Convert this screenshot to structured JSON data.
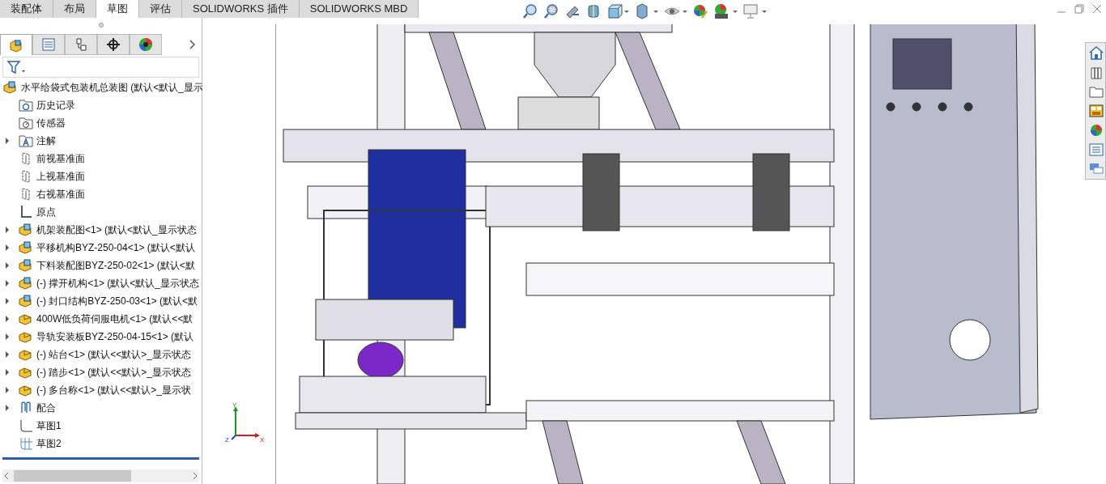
{
  "command_tabs": [
    {
      "label": "装配体",
      "selected": false
    },
    {
      "label": "布局",
      "selected": false
    },
    {
      "label": "草图",
      "selected": true
    },
    {
      "label": "评估",
      "selected": false
    },
    {
      "label": "SOLIDWORKS 插件",
      "selected": false
    },
    {
      "label": "SOLIDWORKS MBD",
      "selected": false
    }
  ],
  "manager_tabs": [
    {
      "kind": "feature",
      "selected": true
    },
    {
      "kind": "property",
      "selected": false
    },
    {
      "kind": "config",
      "selected": false
    },
    {
      "kind": "dimxpert",
      "selected": false
    },
    {
      "kind": "display",
      "selected": false
    }
  ],
  "feature_tree": [
    {
      "kind": "assembly",
      "label": "水平给袋式包装机总装图  (默认<默认_显示",
      "root": true
    },
    {
      "kind": "history",
      "label": "历史记录",
      "expandable": false
    },
    {
      "kind": "sensor",
      "label": "传感器",
      "expandable": false
    },
    {
      "kind": "annotation",
      "label": "注解",
      "expandable": true
    },
    {
      "kind": "plane",
      "label": "前视基准面",
      "expandable": false
    },
    {
      "kind": "plane",
      "label": "上视基准面",
      "expandable": false
    },
    {
      "kind": "plane",
      "label": "右视基准面",
      "expandable": false
    },
    {
      "kind": "origin",
      "label": "原点",
      "expandable": false
    },
    {
      "kind": "assembly",
      "label": "机架装配图<1> (默认<默认_显示状态",
      "expandable": true
    },
    {
      "kind": "assembly",
      "label": "平移机构BYZ-250-04<1> (默认<默认",
      "expandable": true
    },
    {
      "kind": "assembly",
      "label": "下料装配图BYZ-250-02<1> (默认<默",
      "expandable": true
    },
    {
      "kind": "assembly",
      "label": "(-) 撑开机构<1> (默认<默认_显示状态",
      "expandable": true
    },
    {
      "kind": "assembly",
      "label": "(-) 封口结构BYZ-250-03<1> (默认<默",
      "expandable": true
    },
    {
      "kind": "part",
      "label": "400W低负荷伺服电机<1> (默认<<默",
      "expandable": true
    },
    {
      "kind": "part",
      "label": "导轨安装板BYZ-250-04-15<1> (默认",
      "expandable": true
    },
    {
      "kind": "part",
      "label": "(-) 站台<1> (默认<<默认>_显示状态",
      "expandable": true
    },
    {
      "kind": "part",
      "label": "(-) 踏步<1> (默认<<默认>_显示状态",
      "expandable": true
    },
    {
      "kind": "part",
      "label": "(-) 多台称<1> (默认<<默认>_显示状",
      "expandable": true
    },
    {
      "kind": "mates",
      "label": "配合",
      "expandable": true
    },
    {
      "kind": "sketch",
      "label": "草图1",
      "expandable": false
    },
    {
      "kind": "sketch-grid",
      "label": "草图2",
      "expandable": false
    }
  ],
  "triad": {
    "y": "Y",
    "x": "X",
    "z": "Z"
  }
}
